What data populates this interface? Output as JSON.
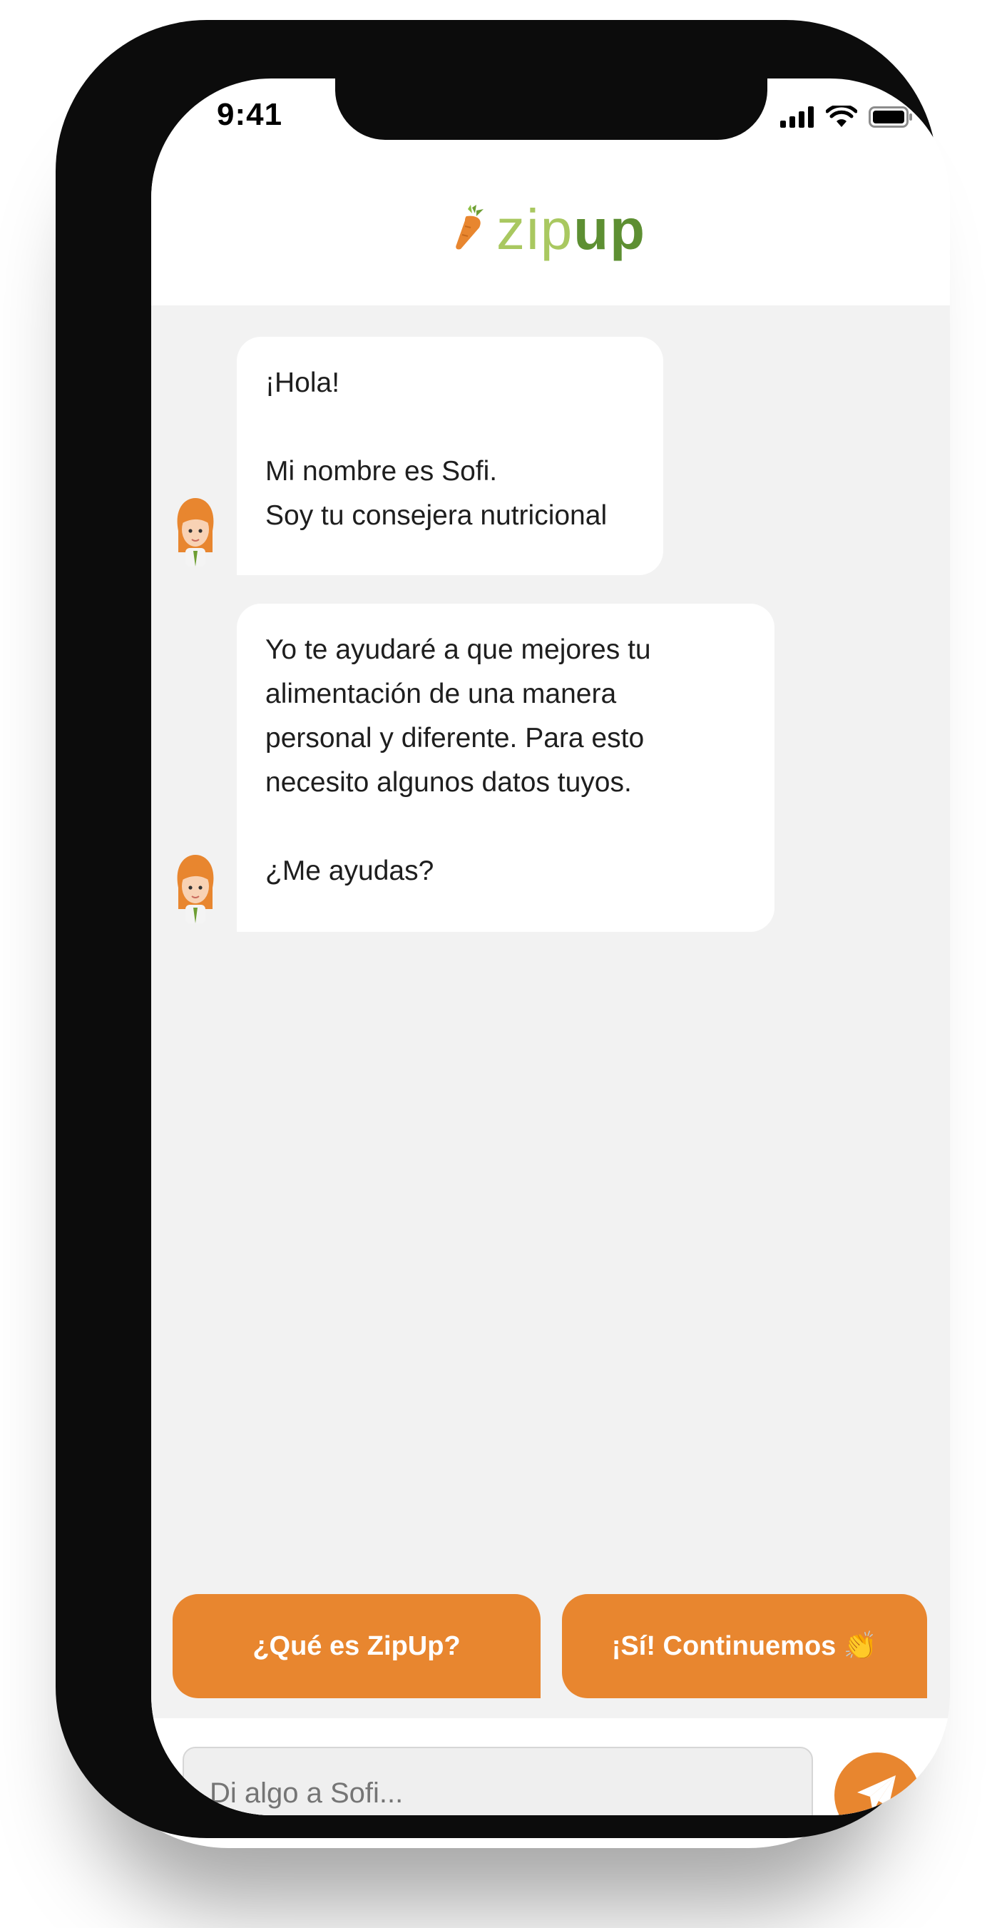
{
  "status_bar": {
    "time": "9:41",
    "signal_icon": "cellular-signal-icon",
    "wifi_icon": "wifi-icon",
    "battery_icon": "battery-icon"
  },
  "header": {
    "logo_icon": "carrot-icon",
    "logo_text_light": "zip",
    "logo_text_bold": "up"
  },
  "chat": {
    "messages": [
      {
        "sender_avatar": "sofi-avatar",
        "text": "¡Hola!\n\nMi nombre es Sofi.\nSoy tu consejera nutricional"
      },
      {
        "sender_avatar": "sofi-avatar",
        "text": "Yo te ayudaré a que mejores tu\nalimentación de una manera\npersonal y diferente. Para esto\nnecesito algunos datos tuyos.\n\n¿Me ayudas?"
      }
    ]
  },
  "quick_replies": [
    {
      "label": "¿Qué es ZipUp?"
    },
    {
      "label": "¡Sí! Continuemos 👏"
    }
  ],
  "composer": {
    "placeholder": "Di algo a Sofi...",
    "value": "",
    "send_icon": "paper-plane-icon"
  },
  "colors": {
    "accent": "#e8862f",
    "brand_light_green": "#a9c860",
    "brand_dark_green": "#5d8f32",
    "chat_background": "#f2f2f2"
  }
}
